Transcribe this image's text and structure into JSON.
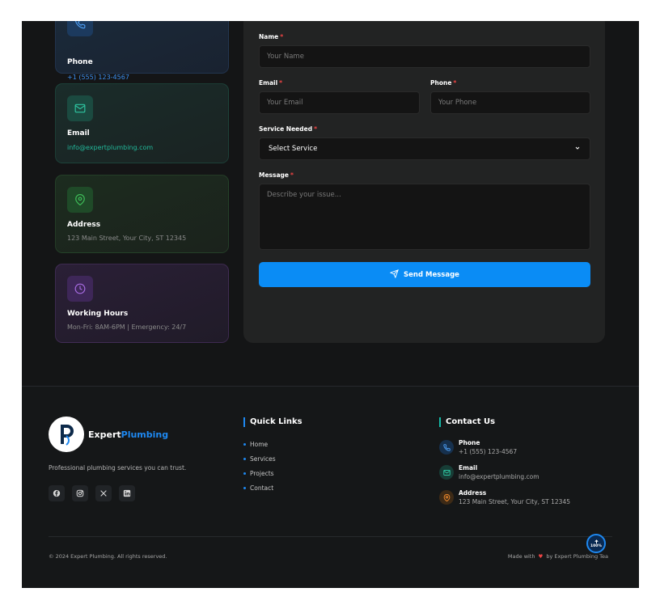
{
  "contact_cards": {
    "phone": {
      "title": "Phone",
      "value": "+1 (555) 123-4567",
      "icon": "phone-icon",
      "color": "#3b82f6"
    },
    "email": {
      "title": "Email",
      "value": "info@expertplumbing.com",
      "icon": "mail-icon",
      "color": "#14b8a6"
    },
    "address": {
      "title": "Address",
      "value": "123 Main Street, Your City, ST 12345",
      "icon": "map-pin-icon",
      "color": "#22c55e"
    },
    "hours": {
      "title": "Working Hours",
      "value": "Mon-Fri: 8AM-6PM | Emergency: 24/7",
      "icon": "clock-icon",
      "color": "#a855f7"
    }
  },
  "form": {
    "name_label": "Name",
    "name_placeholder": "Your Name",
    "email_label": "Email",
    "email_placeholder": "Your Email",
    "phone_label": "Phone",
    "phone_placeholder": "Your Phone",
    "service_label": "Service Needed",
    "service_selected": "Select Service",
    "message_label": "Message",
    "message_placeholder": "Describe your issue...",
    "required_mark": "*",
    "submit_label": "Send Message"
  },
  "footer": {
    "brand_part1": "Expert",
    "brand_part2": "Plumbing",
    "tagline": "Professional plumbing services you can trust.",
    "social_icons": [
      "facebook-icon",
      "instagram-icon",
      "x-icon",
      "linkedin-icon"
    ],
    "quick_links_heading": "Quick Links",
    "quick_links": [
      "Home",
      "Services",
      "Projects",
      "Contact"
    ],
    "contact_heading": "Contact Us",
    "contact_items": [
      {
        "title": "Phone",
        "value": "+1 (555) 123-4567",
        "icon": "phone-icon"
      },
      {
        "title": "Email",
        "value": "info@expertplumbing.com",
        "icon": "mail-icon"
      },
      {
        "title": "Address",
        "value": "123 Main Street, Your City, ST 12345",
        "icon": "map-pin-icon"
      }
    ],
    "copyright": "© 2024 Expert Plumbing. All rights reserved.",
    "made_with_prefix": "Made with",
    "made_with_suffix": "by Expert Plumbing Tea"
  },
  "scroll_top": {
    "percent_label": "100%"
  },
  "colors": {
    "accent": "#1e88f0",
    "button": "#0a8cf5",
    "required": "#ef4444",
    "background": "#151718"
  }
}
